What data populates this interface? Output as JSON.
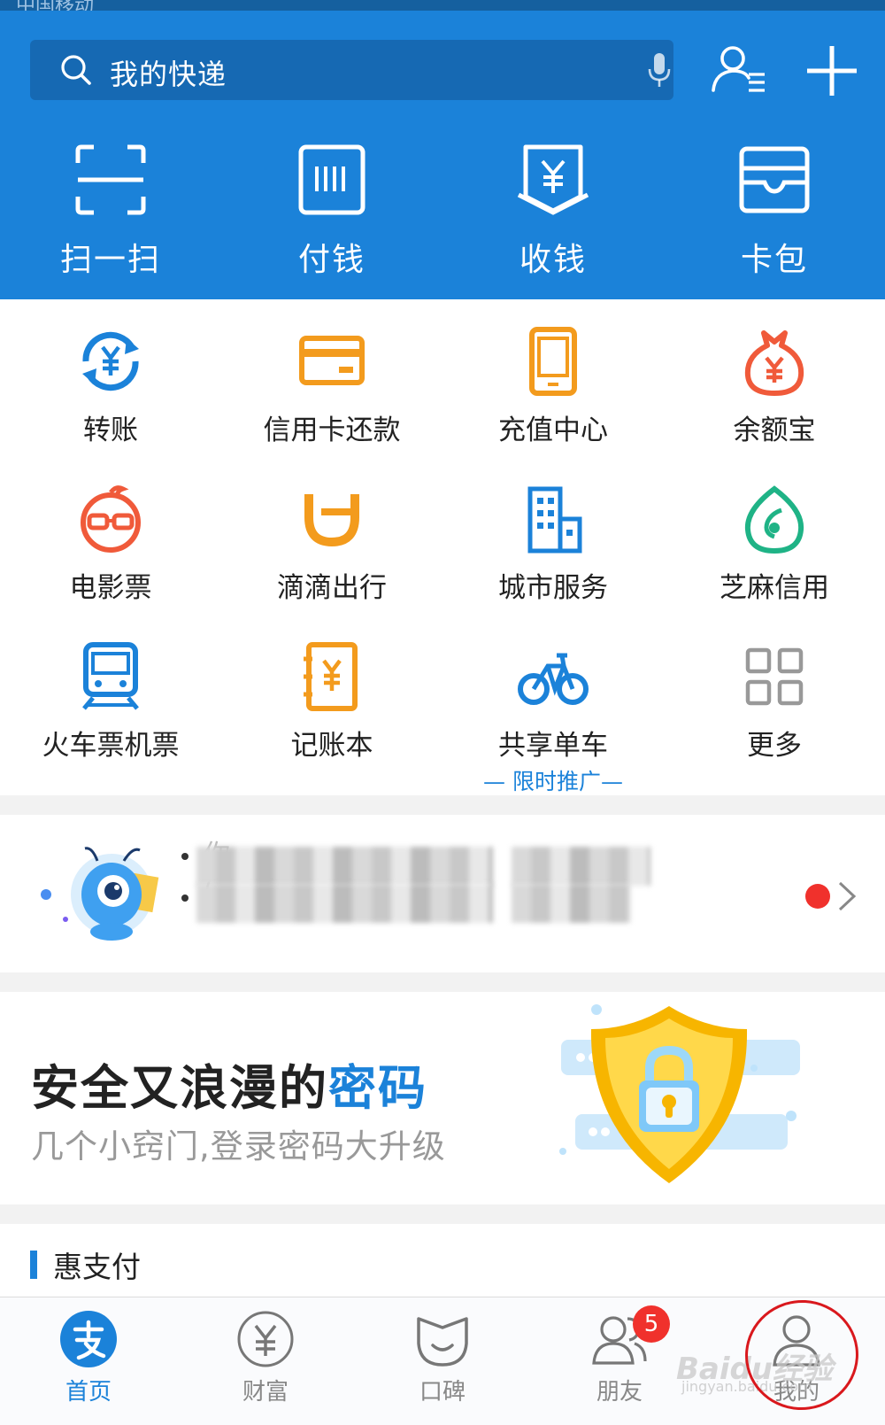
{
  "status_bar": {
    "carrier": "中国移动"
  },
  "search": {
    "placeholder": "我的快递",
    "icon": "search-icon",
    "mic_icon": "microphone-icon"
  },
  "header_actions": {
    "contacts_icon": "contacts-icon",
    "add_icon": "plus-icon"
  },
  "quick_actions": [
    {
      "label": "扫一扫",
      "icon": "scan-icon"
    },
    {
      "label": "付钱",
      "icon": "barcode-icon"
    },
    {
      "label": "收钱",
      "icon": "receive-money-icon"
    },
    {
      "label": "卡包",
      "icon": "card-wallet-icon"
    }
  ],
  "services": [
    {
      "label": "转账",
      "icon": "transfer-icon",
      "color": "#1b82d9"
    },
    {
      "label": "信用卡还款",
      "icon": "credit-card-icon",
      "color": "#f39b1d"
    },
    {
      "label": "充值中心",
      "icon": "phone-recharge-icon",
      "color": "#f39b1d"
    },
    {
      "label": "余额宝",
      "icon": "money-bag-icon",
      "color": "#f05a3a"
    },
    {
      "label": "电影票",
      "icon": "movie-ticket-icon",
      "color": "#f05a3a"
    },
    {
      "label": "滴滴出行",
      "icon": "didi-icon",
      "color": "#f39b1d"
    },
    {
      "label": "城市服务",
      "icon": "city-building-icon",
      "color": "#1b82d9"
    },
    {
      "label": "芝麻信用",
      "icon": "sesame-credit-icon",
      "color": "#1fb386"
    },
    {
      "label": "火车票机票",
      "icon": "train-icon",
      "color": "#1b82d9"
    },
    {
      "label": "记账本",
      "icon": "ledger-icon",
      "color": "#f39b1d"
    },
    {
      "label": "共享单车",
      "icon": "bicycle-icon",
      "color": "#1b82d9",
      "sub": "— 限时推广—"
    },
    {
      "label": "更多",
      "icon": "more-grid-icon",
      "color": "#999999"
    }
  ],
  "notice": {
    "line1_prefix": "你",
    "line2_prefix": "("
  },
  "banner": {
    "title_main": "安全又浪漫的",
    "title_highlight": "密码",
    "subtitle": "几个小窍门,登录密码大升级"
  },
  "section": {
    "title": "惠支付"
  },
  "tabs": [
    {
      "label": "首页",
      "icon": "alipay-home-icon",
      "active": true
    },
    {
      "label": "财富",
      "icon": "wealth-yuan-icon",
      "active": false
    },
    {
      "label": "口碑",
      "icon": "koubei-icon",
      "active": false
    },
    {
      "label": "朋友",
      "icon": "friends-icon",
      "active": false,
      "badge": "5"
    },
    {
      "label": "我的",
      "icon": "profile-icon",
      "active": false
    }
  ],
  "watermark": {
    "brand": "Baidu经验",
    "url": "jingyan.baidu.com"
  },
  "colors": {
    "primary": "#1b82d9",
    "orange": "#f39b1d",
    "red": "#f05a3a",
    "green": "#1fb386",
    "badge": "#f0312c"
  }
}
